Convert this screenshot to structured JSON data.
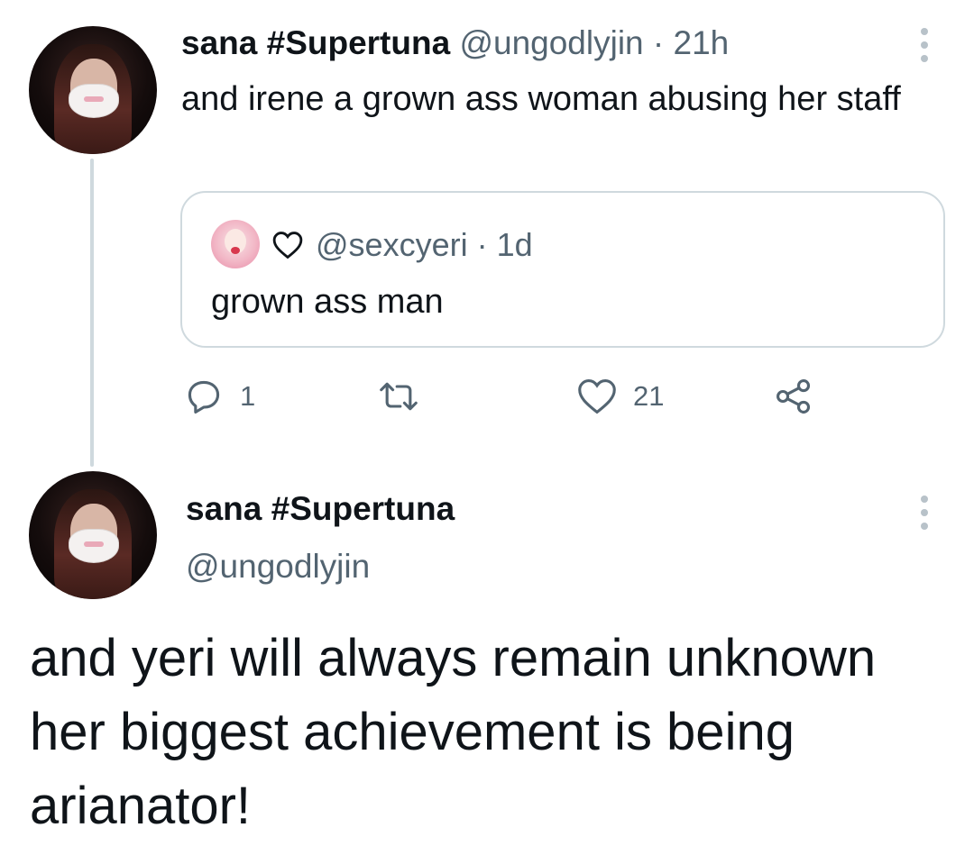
{
  "tweet1": {
    "display_name": "sana #Supertuna",
    "handle": "@ungodlyjin",
    "separator": "·",
    "time": "21h",
    "text": "and irene a grown ass woman abusing her staff",
    "quoted": {
      "heart_label": "♡",
      "handle": "@sexcyeri",
      "separator": "·",
      "time": "1d",
      "text": "grown ass man"
    },
    "actions": {
      "reply_count": "1",
      "retweet_count": "",
      "like_count": "21"
    }
  },
  "tweet2": {
    "display_name": "sana #Supertuna",
    "handle": "@ungodlyjin",
    "text": "and yeri will always remain unknown her biggest achievement is being arianator!"
  },
  "colors": {
    "text_primary": "#0f1419",
    "text_secondary": "#536471",
    "border": "#cfd9de",
    "icon_gray": "#536471"
  },
  "icons": [
    "more-icon",
    "reply-icon",
    "retweet-icon",
    "like-icon",
    "share-icon",
    "heart-icon"
  ]
}
